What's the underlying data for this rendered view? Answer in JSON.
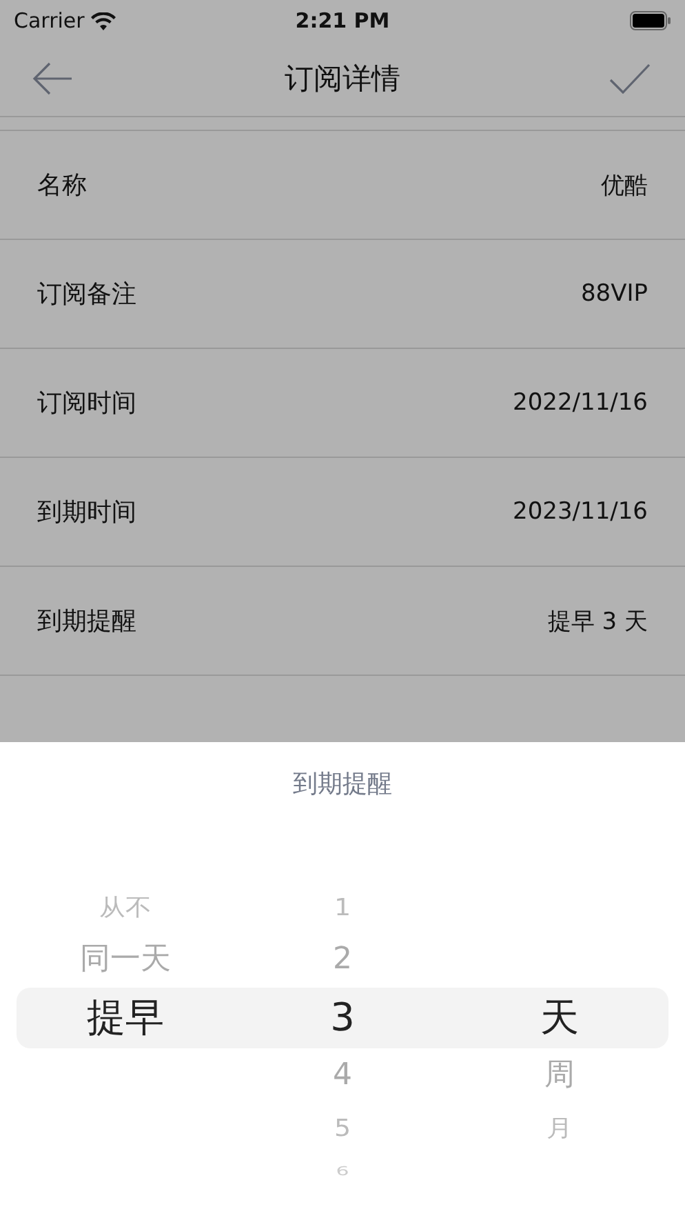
{
  "status_bar": {
    "carrier": "Carrier",
    "time": "2:21 PM"
  },
  "nav": {
    "title": "订阅详情"
  },
  "rows": [
    {
      "label": "名称",
      "value": "优酷"
    },
    {
      "label": "订阅备注",
      "value": "88VIP"
    },
    {
      "label": "订阅时间",
      "value": "2022/11/16"
    },
    {
      "label": "到期时间",
      "value": "2023/11/16"
    },
    {
      "label": "到期提醒",
      "value": "提早 3 天"
    }
  ],
  "picker": {
    "title": "到期提醒",
    "columns": [
      [
        {
          "label": "从不",
          "selected": false
        },
        {
          "label": "同一天",
          "selected": false
        },
        {
          "label": "提早",
          "selected": true
        }
      ],
      [
        {
          "label": "1",
          "selected": false
        },
        {
          "label": "2",
          "selected": false
        },
        {
          "label": "3",
          "selected": true
        },
        {
          "label": "4",
          "selected": false
        },
        {
          "label": "5",
          "selected": false
        },
        {
          "label": "6",
          "selected": false
        }
      ],
      [
        {
          "label": "天",
          "selected": true
        },
        {
          "label": "周",
          "selected": false
        },
        {
          "label": "月",
          "selected": false
        }
      ]
    ]
  }
}
